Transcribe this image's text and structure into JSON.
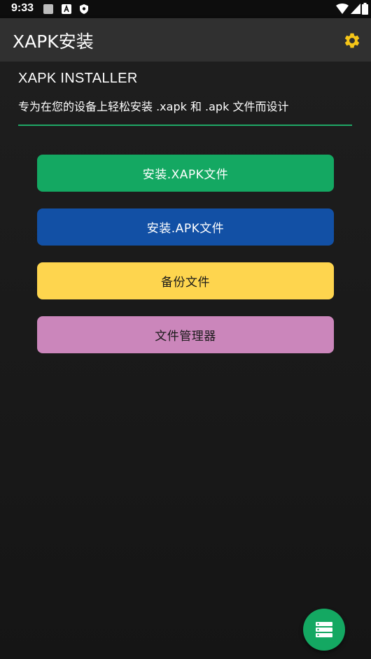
{
  "status_bar": {
    "time": "9:33",
    "left_icons": [
      "square-icon",
      "a-badge-icon",
      "shield-icon"
    ],
    "right_icons": [
      "wifi-icon",
      "signal-icon",
      "battery-icon"
    ]
  },
  "app_bar": {
    "title": "XAPK安装",
    "settings_icon": "gear-icon",
    "accent": "#f5c518"
  },
  "header": {
    "title": "XAPK INSTALLER",
    "subtitle": "专为在您的设备上轻松安装 .xapk 和 .apk 文件而设计",
    "divider_color": "#1fa866"
  },
  "actions": [
    {
      "label": "安装.XAPK文件",
      "color": "#14a862"
    },
    {
      "label": "安装.APK文件",
      "color": "#1250a5"
    },
    {
      "label": "备份文件",
      "color": "#fed54e"
    },
    {
      "label": "文件管理器",
      "color": "#cb86bb"
    }
  ],
  "fab": {
    "icon": "server-list-icon",
    "color": "#14a862"
  }
}
